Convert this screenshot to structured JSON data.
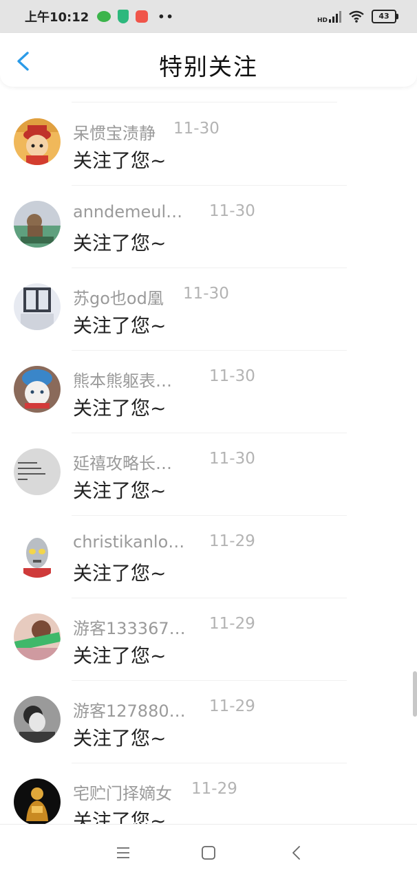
{
  "status_bar": {
    "time": "上午10:12",
    "more": "••",
    "battery": "43",
    "network": "HD"
  },
  "header": {
    "title": "特别关注"
  },
  "items": [
    {
      "name": "呆惯宝渍静",
      "date": "11-30",
      "message": "关注了您~",
      "avatar": "avatar-cartoon-hat"
    },
    {
      "name": "anndemeul…",
      "date": "11-30",
      "message": "关注了您~",
      "avatar": "avatar-girl-sea"
    },
    {
      "name": "苏go也od凰",
      "date": "11-30",
      "message": "关注了您~",
      "avatar": "avatar-window-building"
    },
    {
      "name": "熊本熊躯表…",
      "date": "11-30",
      "message": "关注了您~",
      "avatar": "avatar-cat-hat"
    },
    {
      "name": "延禧攻略长…",
      "date": "11-30",
      "message": "关注了您~",
      "avatar": "avatar-text-gray"
    },
    {
      "name": "christikanlo…",
      "date": "11-29",
      "message": "关注了您~",
      "avatar": "avatar-ultraman"
    },
    {
      "name": "游客133367…",
      "date": "11-29",
      "message": "关注了您~",
      "avatar": "avatar-girl-green"
    },
    {
      "name": "游客127880…",
      "date": "11-29",
      "message": "关注了您~",
      "avatar": "avatar-bw-portrait"
    },
    {
      "name": "宅贮门择嫡女",
      "date": "11-29",
      "message": "关注了您~",
      "avatar": "avatar-golden-statue"
    }
  ],
  "colors": {
    "accent": "#2b9be8",
    "name": "#9a9a9a",
    "date": "#b3b3b3",
    "message": "#222222"
  }
}
